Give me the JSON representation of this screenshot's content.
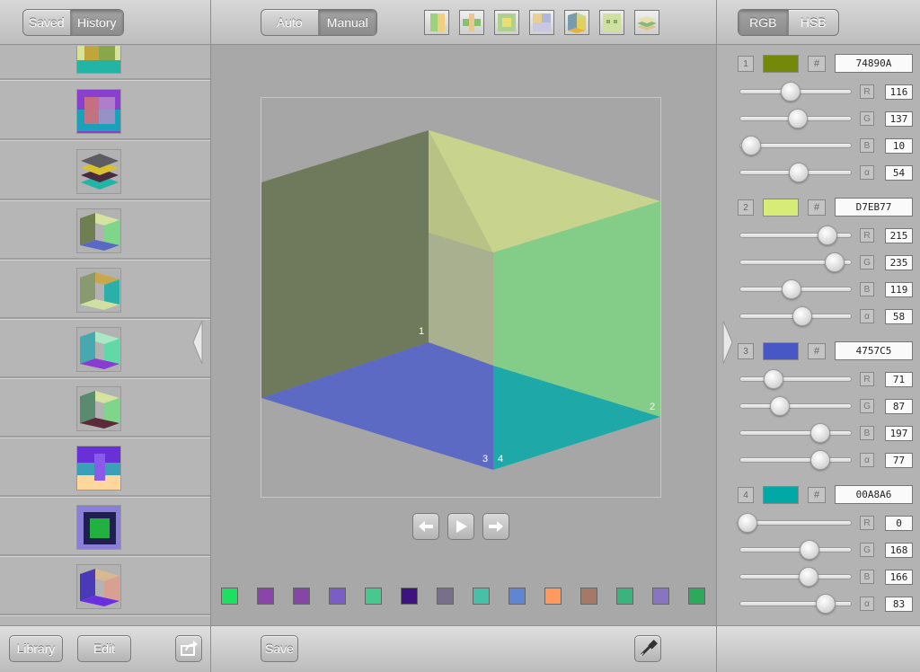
{
  "left_panel": {
    "tabs": [
      "Saved",
      "History"
    ],
    "active_tab": "History",
    "bottom": {
      "library": "Library",
      "edit": "Edit"
    }
  },
  "center_panel": {
    "modes": [
      "Auto",
      "Manual"
    ],
    "active_mode": "Manual",
    "layout_icons": [
      "vertical-split-layout-icon",
      "horizontal-cross-layout-icon",
      "nested-square-layout-icon",
      "quadrant-layout-icon",
      "cube-layout-icon",
      "dots-layout-icon",
      "stacked-layers-layout-icon"
    ],
    "cube_labels": [
      "1",
      "2",
      "3",
      "4"
    ],
    "save": "Save",
    "palette": [
      "#1ee060",
      "#8a45a8",
      "#8646a6",
      "#7a5dc6",
      "#48c88e",
      "#3e1280",
      "#76708a",
      "#48c0a8",
      "#5e86d2",
      "#ff9a5e",
      "#a67868",
      "#3cb27e",
      "#8a74c0",
      "#2ea95b"
    ]
  },
  "right_panel": {
    "modes": [
      "RGB",
      "HSB"
    ],
    "active_mode": "RGB",
    "colors": [
      {
        "index": "1",
        "hex": "74890A",
        "swatch": "#74890a",
        "channels": [
          {
            "label": "R",
            "value": "116"
          },
          {
            "label": "G",
            "value": "137"
          },
          {
            "label": "B",
            "value": "10"
          },
          {
            "label": "α",
            "value": "54"
          }
        ]
      },
      {
        "index": "2",
        "hex": "D7EB77",
        "swatch": "#d7eb77",
        "channels": [
          {
            "label": "R",
            "value": "215"
          },
          {
            "label": "G",
            "value": "235"
          },
          {
            "label": "B",
            "value": "119"
          },
          {
            "label": "α",
            "value": "58"
          }
        ]
      },
      {
        "index": "3",
        "hex": "4757C5",
        "swatch": "#4757c5",
        "channels": [
          {
            "label": "R",
            "value": "71"
          },
          {
            "label": "G",
            "value": "87"
          },
          {
            "label": "B",
            "value": "197"
          },
          {
            "label": "α",
            "value": "77"
          }
        ]
      },
      {
        "index": "4",
        "hex": "00A8A6",
        "swatch": "#00a8a6",
        "channels": [
          {
            "label": "R",
            "value": "0"
          },
          {
            "label": "G",
            "value": "168"
          },
          {
            "label": "B",
            "value": "166"
          },
          {
            "label": "α",
            "value": "83"
          }
        ]
      }
    ]
  }
}
